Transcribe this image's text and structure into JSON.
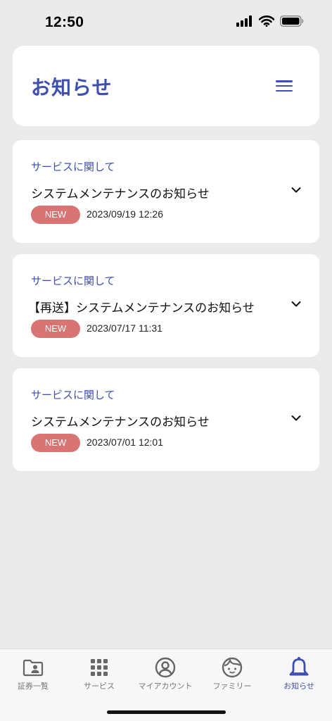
{
  "status_bar": {
    "time": "12:50"
  },
  "header": {
    "title": "お知らせ",
    "menu_icon": "hamburger-menu-icon"
  },
  "notices": [
    {
      "category": "サービスに関して",
      "title": "システムメンテナンスのお知らせ",
      "badge": "NEW",
      "date": "2023/09/19 12:26"
    },
    {
      "category": "サービスに関して",
      "title": "【再送】システムメンテナンスのお知らせ",
      "badge": "NEW",
      "date": "2023/07/17 11:31"
    },
    {
      "category": "サービスに関して",
      "title": "システムメンテナンスのお知らせ",
      "badge": "NEW",
      "date": "2023/07/01 12:01"
    }
  ],
  "tab_bar": {
    "items": [
      {
        "label": "証券一覧",
        "icon": "id-card-folder-icon",
        "active": false
      },
      {
        "label": "サービス",
        "icon": "grid-icon",
        "active": false
      },
      {
        "label": "マイアカウント",
        "icon": "user-circle-icon",
        "active": false
      },
      {
        "label": "ファミリー",
        "icon": "child-face-icon",
        "active": false
      },
      {
        "label": "お知らせ",
        "icon": "bell-icon",
        "active": true
      }
    ]
  },
  "colors": {
    "accent": "#3f4fb0",
    "badge": "#d97474",
    "background": "#ebebeb",
    "card": "#ffffff",
    "inactive_tab": "#777777"
  }
}
